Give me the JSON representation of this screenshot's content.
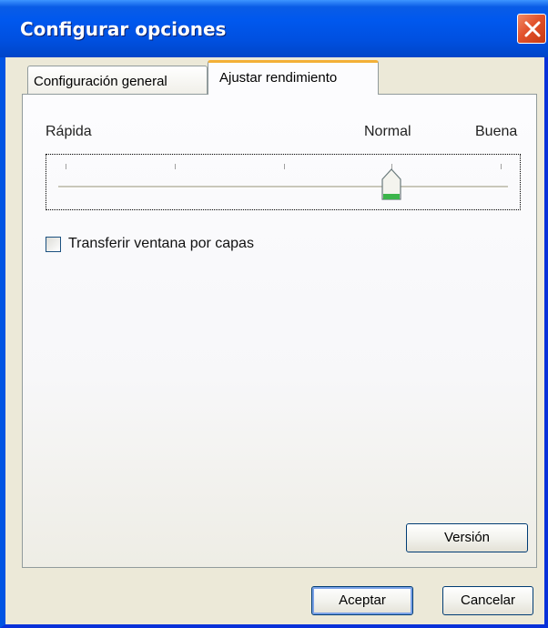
{
  "window": {
    "title": "Configurar opciones"
  },
  "tabs": [
    {
      "label": "Configuración general",
      "active": false
    },
    {
      "label": "Ajustar rendimiento",
      "active": true
    }
  ],
  "slider": {
    "label_left": "Rápida",
    "label_middle": "Normal",
    "label_right": "Buena",
    "value_fraction": 0.75
  },
  "options": {
    "layered_window_label": "Transferir ventana por capas",
    "layered_window_checked": false
  },
  "buttons": {
    "version": "Versión",
    "ok": "Aceptar",
    "cancel": "Cancelar"
  },
  "colors": {
    "title_bar": "#0054e3",
    "close_button": "#e2522c",
    "active_tab_accent": "#f3b037",
    "thumb_green": "#3bb54a"
  }
}
